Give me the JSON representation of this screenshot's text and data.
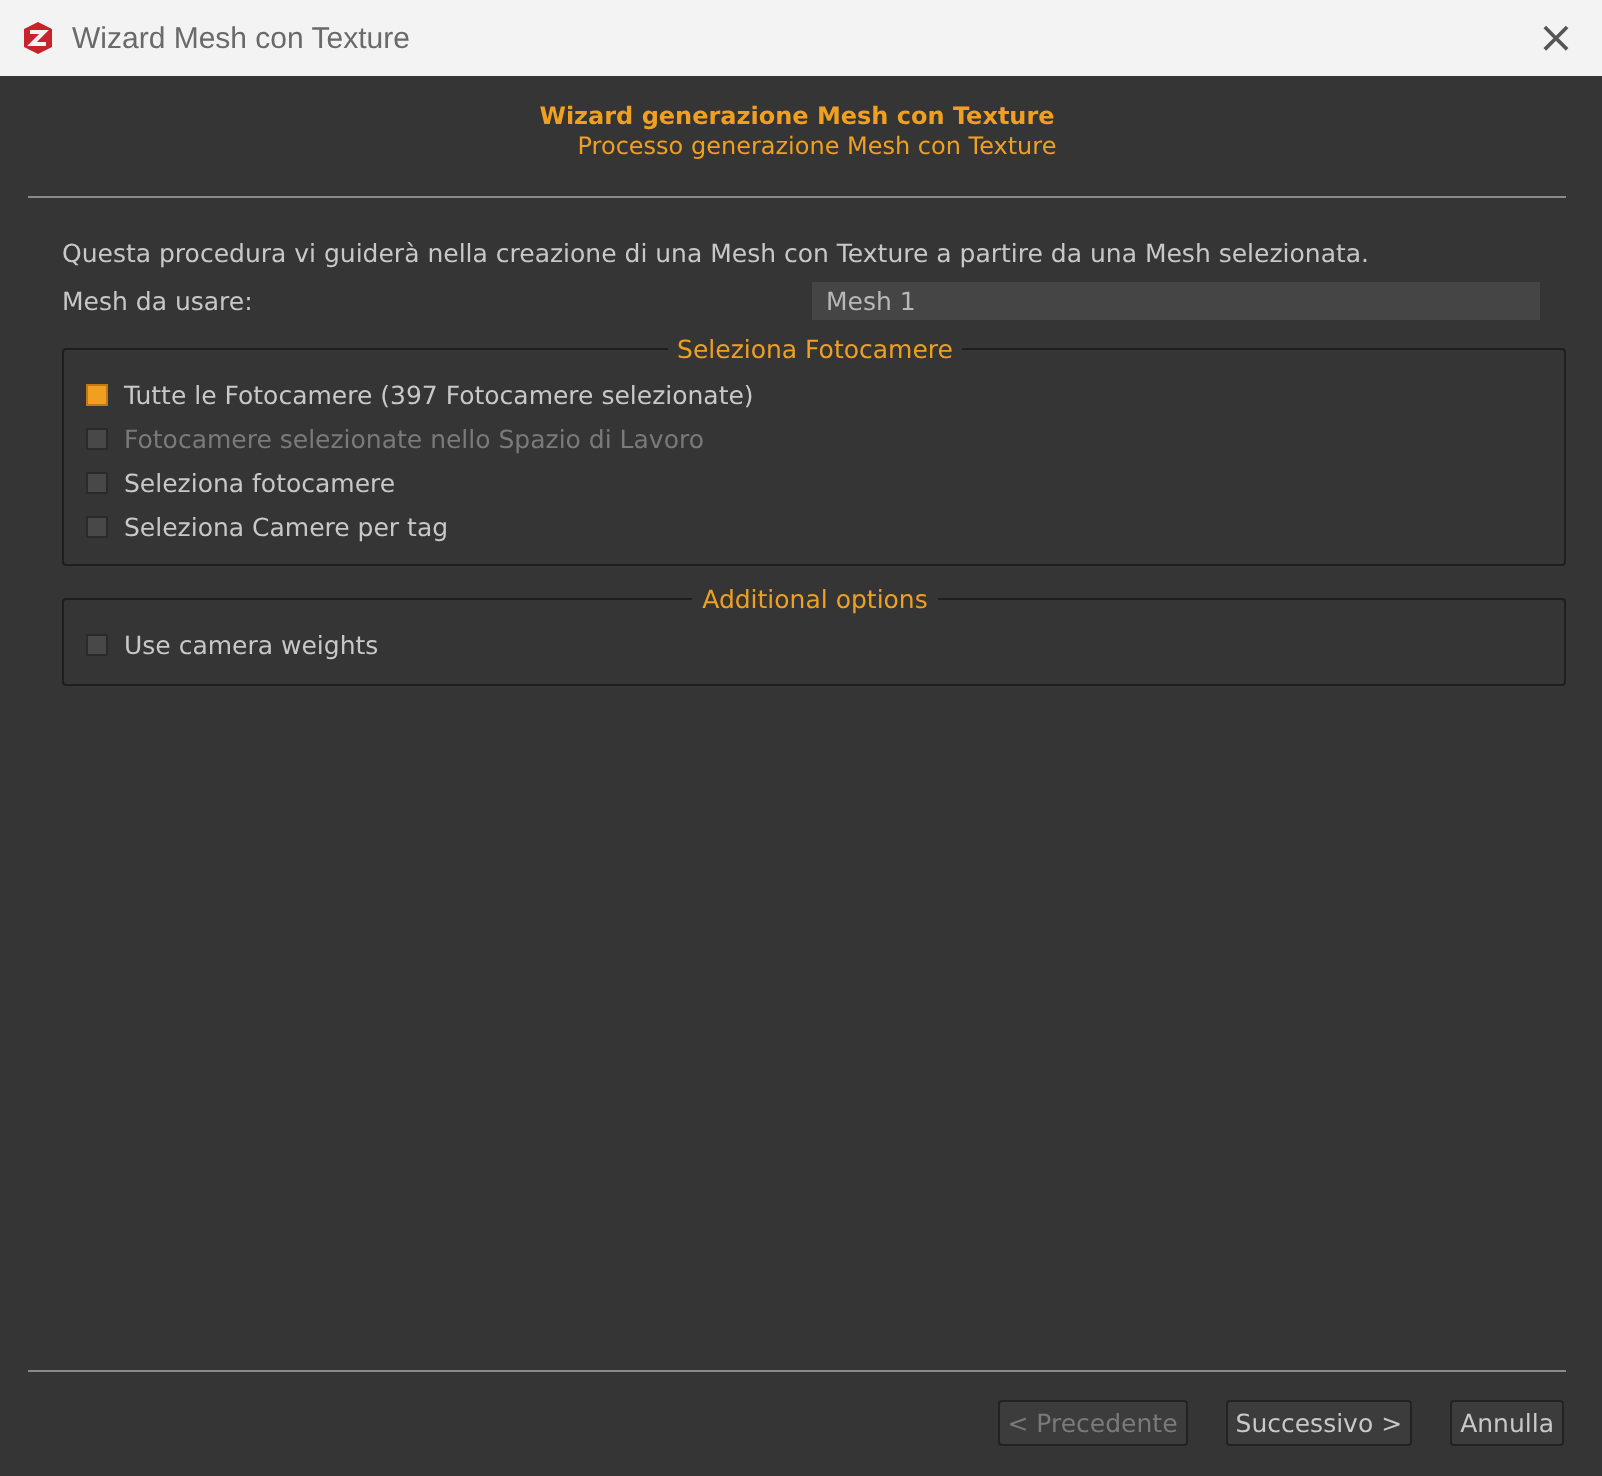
{
  "window": {
    "title": "Wizard Mesh con Texture",
    "close": "×"
  },
  "header": {
    "title": "Wizard generazione Mesh con Texture",
    "subtitle": "Processo generazione Mesh con Texture"
  },
  "description": "Questa procedura vi guiderà nella creazione di una Mesh con Texture a partire da una Mesh selezionata.",
  "mesh_field": {
    "label": "Mesh da usare:",
    "value": "Mesh 1"
  },
  "camera_group": {
    "title": "Seleziona Fotocamere",
    "options": [
      {
        "label": "Tutte le Fotocamere (397 Fotocamere selezionate)",
        "selected": true,
        "disabled": false
      },
      {
        "label": "Fotocamere selezionate nello Spazio di Lavoro",
        "selected": false,
        "disabled": true
      },
      {
        "label": "Seleziona fotocamere",
        "selected": false,
        "disabled": false
      },
      {
        "label": "Seleziona Camere per tag",
        "selected": false,
        "disabled": false
      }
    ]
  },
  "additional_group": {
    "title": "Additional options",
    "options": [
      {
        "label": "Use camera weights",
        "checked": false
      }
    ]
  },
  "buttons": [
    {
      "label": "< Precedente",
      "disabled": true
    },
    {
      "label": "Successivo >",
      "disabled": false
    },
    {
      "label": "Annulla",
      "disabled": false
    }
  ]
}
